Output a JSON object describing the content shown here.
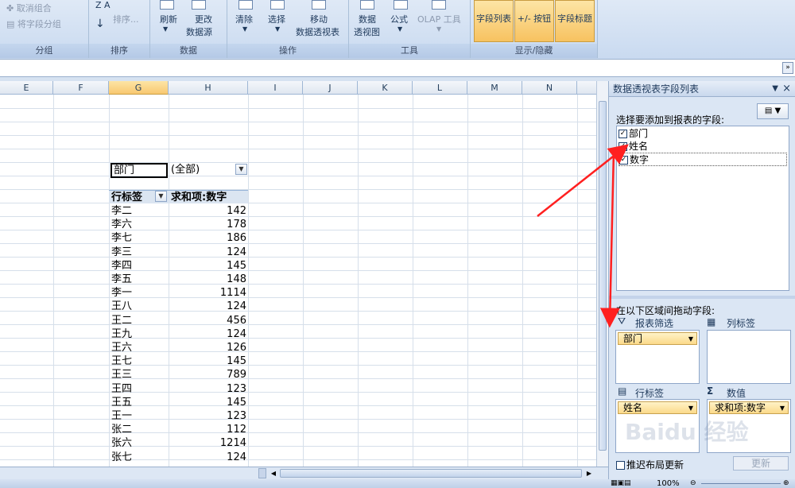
{
  "ribbon": {
    "group1": {
      "ungroup": "取消组合",
      "field_ungroup": "将字段分组",
      "label": "分组"
    },
    "group2": {
      "sort": "排序...",
      "az": "Z A",
      "label": "排序"
    },
    "group3": {
      "refresh": "刷新",
      "change_l1": "更改",
      "change_l2": "数据源",
      "label": "数据"
    },
    "group4": {
      "clear": "清除",
      "select": "选择",
      "move_l1": "移动",
      "move_l2": "数据透视表",
      "label": "操作"
    },
    "group5": {
      "chart_l1": "数据",
      "chart_l2": "透视图",
      "formula": "公式",
      "olap": "OLAP 工具",
      "label": "工具"
    },
    "group6": {
      "field_list": "字段列表",
      "buttons": "+/- 按钮",
      "headers": "字段标题",
      "label": "显示/隐藏"
    }
  },
  "columns": [
    "E",
    "F",
    "G",
    "H",
    "I",
    "J",
    "K",
    "L",
    "M",
    "N"
  ],
  "pivot": {
    "filter_field": "部门",
    "filter_value": "(全部)",
    "row_label_header": "行标签",
    "value_header": "求和项:数字",
    "rows": [
      {
        "name": "李二",
        "value": "142"
      },
      {
        "name": "李六",
        "value": "178"
      },
      {
        "name": "李七",
        "value": "186"
      },
      {
        "name": "李三",
        "value": "124"
      },
      {
        "name": "李四",
        "value": "145"
      },
      {
        "name": "李五",
        "value": "148"
      },
      {
        "name": "李一",
        "value": "1114"
      },
      {
        "name": "王八",
        "value": "124"
      },
      {
        "name": "王二",
        "value": "456"
      },
      {
        "name": "王九",
        "value": "124"
      },
      {
        "name": "王六",
        "value": "126"
      },
      {
        "name": "王七",
        "value": "145"
      },
      {
        "name": "王三",
        "value": "789"
      },
      {
        "name": "王四",
        "value": "123"
      },
      {
        "name": "王五",
        "value": "145"
      },
      {
        "name": "王一",
        "value": "123"
      },
      {
        "name": "张二",
        "value": "112"
      },
      {
        "name": "张六",
        "value": "1214"
      },
      {
        "name": "张七",
        "value": "124"
      }
    ]
  },
  "pane": {
    "title": "数据透视表字段列表",
    "choose_label": "选择要添加到报表的字段:",
    "fields": [
      {
        "name": "部门",
        "checked": true
      },
      {
        "name": "姓名",
        "checked": true
      },
      {
        "name": "数字",
        "checked": true
      }
    ],
    "drag_label": "在以下区域间拖动字段:",
    "report_filter": "报表筛选",
    "column_labels": "列标签",
    "row_labels": "行标签",
    "values": "数值",
    "filter_chip": "部门",
    "row_chip": "姓名",
    "value_chip": "求和项:数字",
    "defer_label": "推迟布局更新",
    "update_button": "更新"
  },
  "status": {
    "zoom": "100%"
  },
  "colors": {
    "arrow": "#ff2020",
    "selected_header": "#f8c870",
    "ribbon": "#c9daf0"
  },
  "watermark": "Baidu 经验"
}
